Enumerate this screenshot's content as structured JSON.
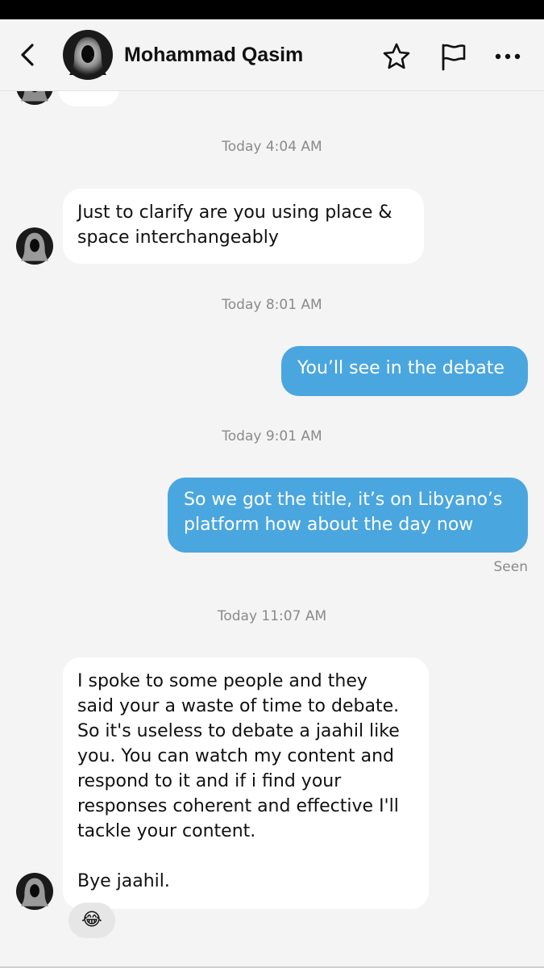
{
  "header": {
    "contact_name": "Mohammad Qasim",
    "back_icon": "chevron-left-icon",
    "star_icon": "star-icon",
    "flag_icon": "flag-icon",
    "more_icon": "more-horizontal-icon"
  },
  "messages": [
    {
      "type": "timestamp",
      "text": "Today 4:04 AM"
    },
    {
      "type": "incoming",
      "lines": [
        "Just to clarify are you using place &",
        "space interchangeably"
      ]
    },
    {
      "type": "timestamp",
      "text": "Today 8:01 AM"
    },
    {
      "type": "outgoing",
      "lines": [
        "You’ll see in the debate"
      ]
    },
    {
      "type": "timestamp",
      "text": "Today 9:01 AM"
    },
    {
      "type": "outgoing",
      "lines": [
        "So we got the title, it’s on Libyano’s",
        "platform how about the day now"
      ],
      "status": "Seen"
    },
    {
      "type": "timestamp",
      "text": "Today 11:07 AM"
    },
    {
      "type": "incoming",
      "lines": [
        "I spoke to some people and they",
        "said your a waste of time to debate.",
        "So it's useless to debate a jaahil like",
        "you. You can watch my content and",
        "respond to it and if i find your",
        "responses coherent and effective I'll",
        "tackle your content.",
        "",
        "Bye jaahil."
      ],
      "reaction": "😂"
    }
  ],
  "colors": {
    "outgoing_bubble": "#4aa6df",
    "incoming_bubble": "#ffffff",
    "background": "#f4f4f4",
    "timestamp": "#8a8a8a"
  }
}
